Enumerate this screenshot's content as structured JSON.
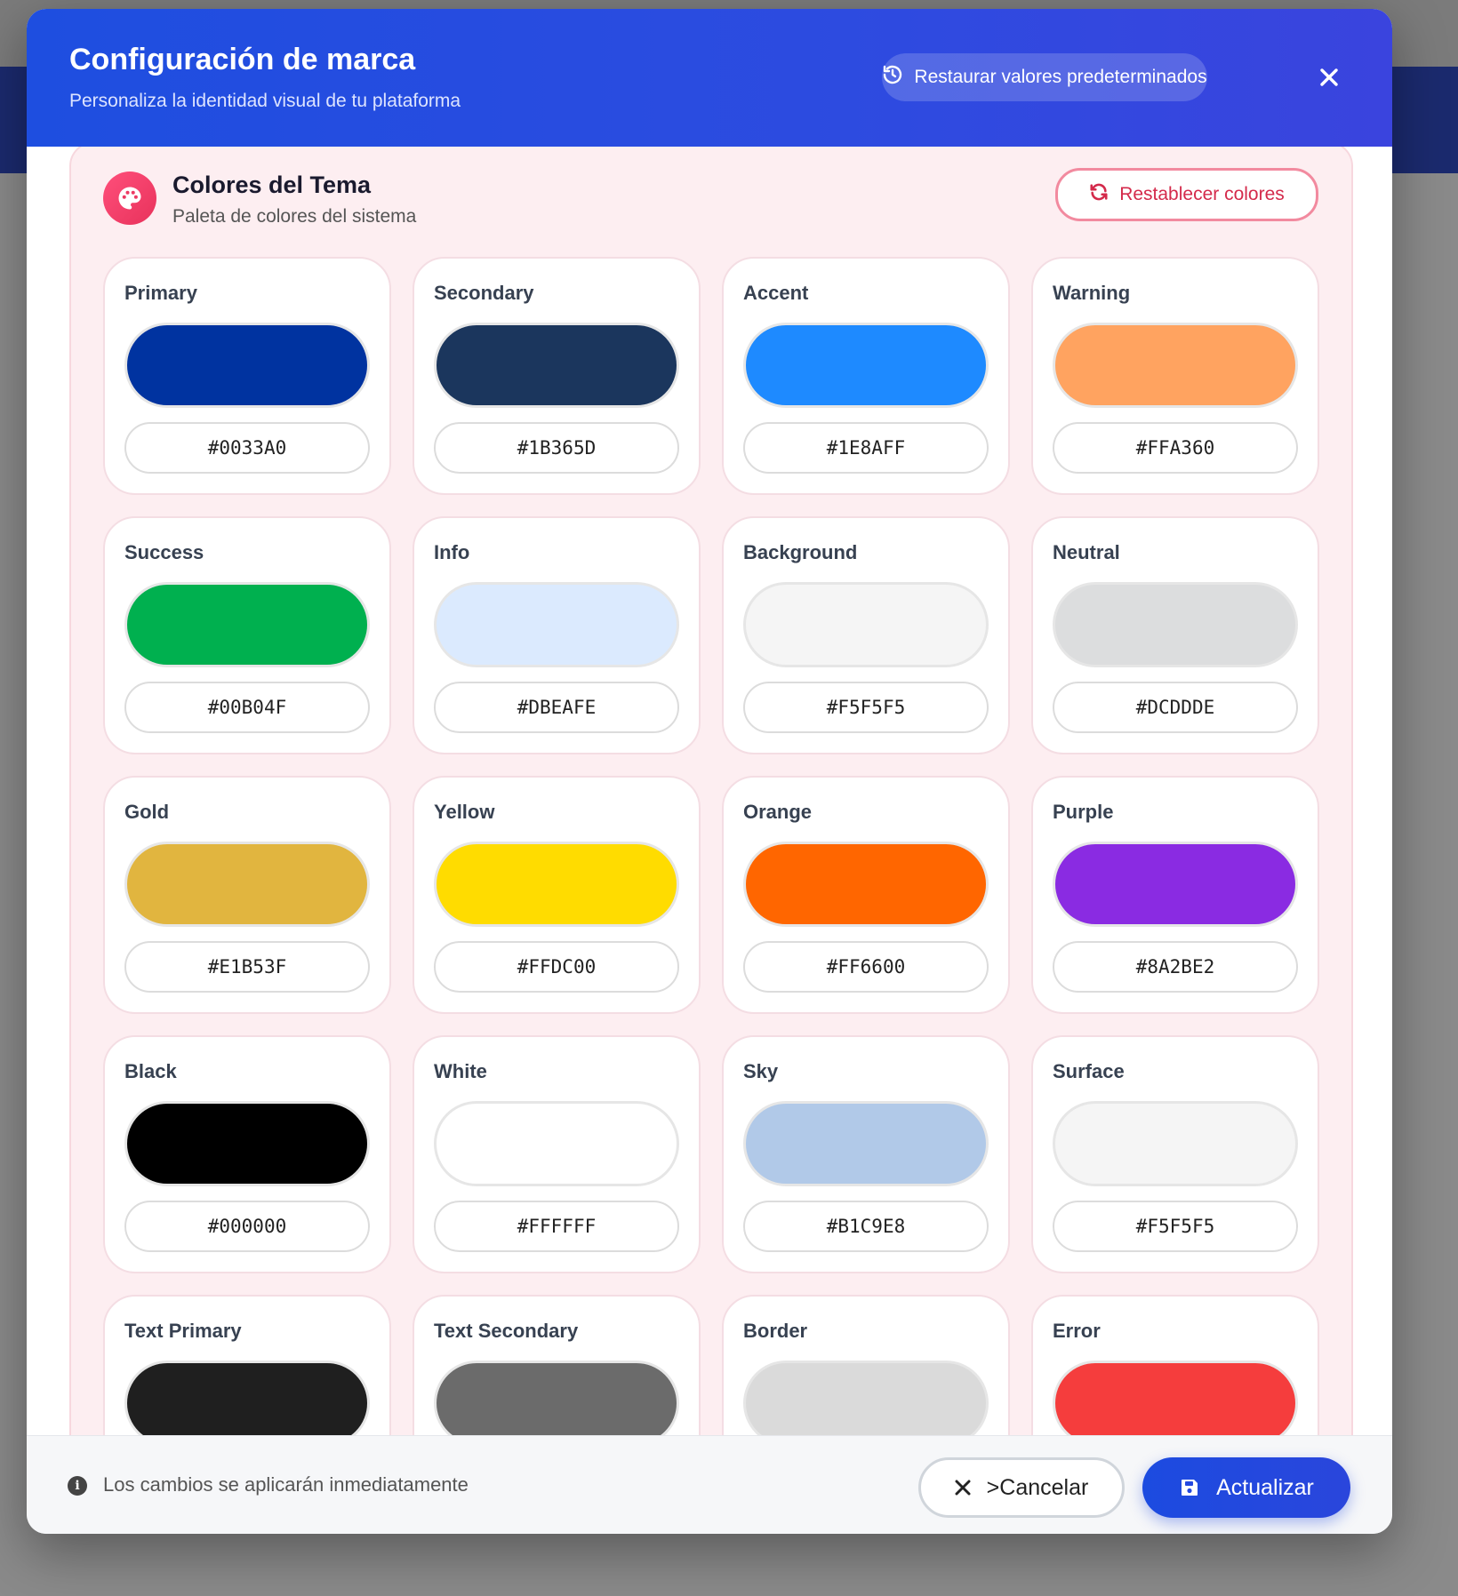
{
  "header": {
    "title": "Configuración de marca",
    "subtitle": "Personaliza la identidad visual de tu plataforma",
    "restore_label": "Restaurar valores predeterminados"
  },
  "section": {
    "title": "Colores del Tema",
    "subtitle": "Paleta de colores del sistema",
    "reset_label": "Restablecer colores"
  },
  "colors": [
    {
      "label": "Primary",
      "hex": "#0033A0"
    },
    {
      "label": "Secondary",
      "hex": "#1B365D"
    },
    {
      "label": "Accent",
      "hex": "#1E8AFF"
    },
    {
      "label": "Warning",
      "hex": "#FFA360"
    },
    {
      "label": "Success",
      "hex": "#00B04F"
    },
    {
      "label": "Info",
      "hex": "#DBEAFE"
    },
    {
      "label": "Background",
      "hex": "#F5F5F5"
    },
    {
      "label": "Neutral",
      "hex": "#DCDDDE"
    },
    {
      "label": "Gold",
      "hex": "#E1B53F"
    },
    {
      "label": "Yellow",
      "hex": "#FFDC00"
    },
    {
      "label": "Orange",
      "hex": "#FF6600"
    },
    {
      "label": "Purple",
      "hex": "#8A2BE2"
    },
    {
      "label": "Black",
      "hex": "#000000"
    },
    {
      "label": "White",
      "hex": "#FFFFFF"
    },
    {
      "label": "Sky",
      "hex": "#B1C9E8"
    },
    {
      "label": "Surface",
      "hex": "#F5F5F5"
    },
    {
      "label": "Text Primary",
      "swatch": "#1F1F1F"
    },
    {
      "label": "Text Secondary",
      "swatch": "#6B6B6B"
    },
    {
      "label": "Border",
      "swatch": "#DADADA"
    },
    {
      "label": "Error",
      "swatch": "#F53D3D"
    }
  ],
  "footer": {
    "info_text": "Los cambios se aplicarán inmediatamente",
    "cancel_label": ">Cancelar",
    "update_label": "Actualizar"
  }
}
